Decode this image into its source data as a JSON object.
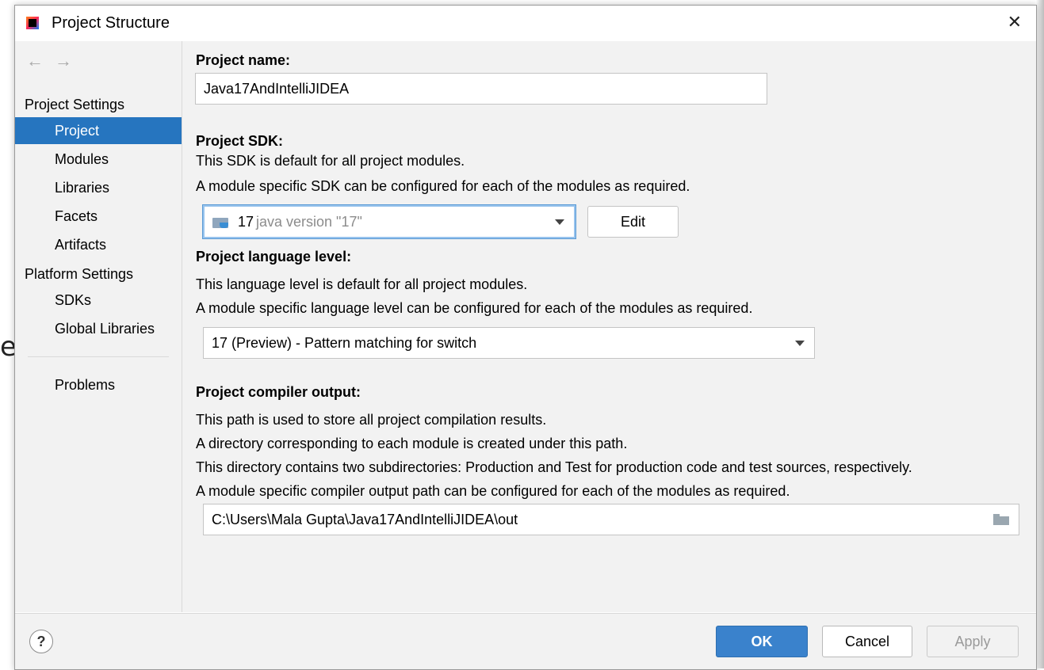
{
  "window": {
    "title": "Project Structure"
  },
  "nav": {
    "back": "←",
    "forward": "→"
  },
  "sidebar": {
    "project_settings_header": "Project Settings",
    "project_items": [
      "Project",
      "Modules",
      "Libraries",
      "Facets",
      "Artifacts"
    ],
    "platform_settings_header": "Platform Settings",
    "platform_items": [
      "SDKs",
      "Global Libraries"
    ],
    "problems": "Problems",
    "selected": "Project"
  },
  "main": {
    "project_name": {
      "label": "Project name:",
      "value": "Java17AndIntelliJIDEA"
    },
    "project_sdk": {
      "label": "Project SDK:",
      "desc1": "This SDK is default for all project modules.",
      "desc2": "A module specific SDK can be configured for each of the modules as required.",
      "selected_version": "17",
      "selected_desc": "java version \"17\"",
      "edit_button": "Edit"
    },
    "language_level": {
      "label": "Project language level:",
      "desc1": "This language level is default for all project modules.",
      "desc2": "A module specific language level can be configured for each of the modules as required.",
      "selected": "17 (Preview) - Pattern matching for switch"
    },
    "compiler_output": {
      "label": "Project compiler output:",
      "desc1": "This path is used to store all project compilation results.",
      "desc2": "A directory corresponding to each module is created under this path.",
      "desc3": "This directory contains two subdirectories: Production and Test for production code and test sources, respectively.",
      "desc4": "A module specific compiler output path can be configured for each of the modules as required.",
      "path": "C:\\Users\\Mala Gupta\\Java17AndIntelliJIDEA\\out"
    }
  },
  "footer": {
    "help": "?",
    "ok": "OK",
    "cancel": "Cancel",
    "apply": "Apply"
  },
  "colors": {
    "selection": "#2675bf",
    "ok_button": "#3a82cc",
    "panel_bg": "#f2f2f2"
  },
  "icons": [
    "app-icon",
    "close-icon",
    "back-arrow-icon",
    "forward-arrow-icon",
    "sdk-folder-icon",
    "dropdown-arrow-icon",
    "browse-folder-icon",
    "help-icon"
  ]
}
